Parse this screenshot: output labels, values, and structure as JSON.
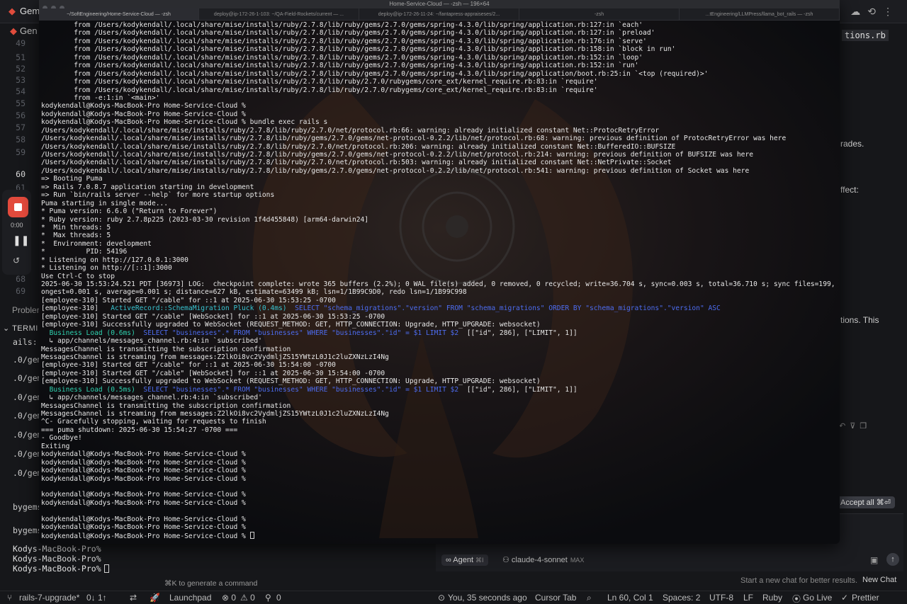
{
  "editor": {
    "tab_title": "Gem",
    "tab2_title": "Gen",
    "line_numbers": [
      "49",
      "51",
      "52",
      "53",
      "54",
      "55",
      "56",
      "57",
      "58",
      "59",
      "60",
      "61",
      "67",
      "68",
      "69"
    ],
    "active_line": "60",
    "problems_label": "Probler",
    "terminal_label": "TERMI",
    "terminal_fragments": [
      "ails::",
      ".0/gem",
      ".0/gem",
      ".0/gem",
      ".0/gem",
      ".0/gem",
      ".0/gem",
      ".0/gem",
      "bygems",
      "bygems"
    ],
    "bottom_prompts": [
      "Kodys-MacBook-Pro%",
      "Kodys-MacBook-Pro%",
      "Kodys-MacBook-Pro%"
    ],
    "generate_hint": "⌘K to generate a command"
  },
  "chat": {
    "file_chip": "tions.rb",
    "fragments": [
      "rades.",
      "ffect:",
      "tions. This"
    ],
    "accept_all": "Accept all ⌘⏎",
    "agent_label": "∞ Agent",
    "agent_kbd": "⌘I",
    "model_label": "claude-4-sonnet",
    "model_badge": "MAX",
    "hint": "Start a new chat for better results.",
    "new_chat": "New Chat"
  },
  "recording": {
    "time": "0:00"
  },
  "statusbar": {
    "branch": "rails-7-upgrade*",
    "sync": "0↓ 1↑",
    "launchpad": "Launchpad",
    "errors": "⊗ 0",
    "warnings": "⚠ 0",
    "ports": "0",
    "blame": "You, 35 seconds ago",
    "cursor_tab": "Cursor Tab",
    "position": "Ln 60, Col 1",
    "spaces": "Spaces: 2",
    "encoding": "UTF-8",
    "eol": "LF",
    "language": "Ruby",
    "go_live": "Go Live",
    "prettier": "Prettier"
  },
  "terminal": {
    "window_title": "Home-Service-Cloud — -zsh — 196×64",
    "tabs": [
      "~/SoftEngineering/Home-Service-Cloud — -zsh",
      "deploy@ip-172-26-1-103: ~/QA-Field-Rockets/current — ...",
      "deploy@ip-172-26-11-24: ~/fantapress-appraiseses/2...",
      "-zsh",
      "...tEngineering/LLMPress/llama_bot_rails — -zsh"
    ],
    "lines": [
      [
        {
          "t": "        from /Users/kodykendall/.local/share/mise/installs/ruby/2.7.8/lib/ruby/gems/2.7.0/gems/spring-4.3.0/lib/spring/application.rb:127:in `each'"
        }
      ],
      [
        {
          "t": "        from /Users/kodykendall/.local/share/mise/installs/ruby/2.7.8/lib/ruby/gems/2.7.0/gems/spring-4.3.0/lib/spring/application.rb:127:in `preload'"
        }
      ],
      [
        {
          "t": "        from /Users/kodykendall/.local/share/mise/installs/ruby/2.7.8/lib/ruby/gems/2.7.0/gems/spring-4.3.0/lib/spring/application.rb:176:in `serve'"
        }
      ],
      [
        {
          "t": "        from /Users/kodykendall/.local/share/mise/installs/ruby/2.7.8/lib/ruby/gems/2.7.0/gems/spring-4.3.0/lib/spring/application.rb:158:in `block in run'"
        }
      ],
      [
        {
          "t": "        from /Users/kodykendall/.local/share/mise/installs/ruby/2.7.8/lib/ruby/gems/2.7.0/gems/spring-4.3.0/lib/spring/application.rb:152:in `loop'"
        }
      ],
      [
        {
          "t": "        from /Users/kodykendall/.local/share/mise/installs/ruby/2.7.8/lib/ruby/gems/2.7.0/gems/spring-4.3.0/lib/spring/application.rb:152:in `run'"
        }
      ],
      [
        {
          "t": "        from /Users/kodykendall/.local/share/mise/installs/ruby/2.7.8/lib/ruby/gems/2.7.0/gems/spring-4.3.0/lib/spring/application/boot.rb:25:in `<top (required)>'"
        }
      ],
      [
        {
          "t": "        from /Users/kodykendall/.local/share/mise/installs/ruby/2.7.8/lib/ruby/2.7.0/rubygems/core_ext/kernel_require.rb:83:in `require'"
        }
      ],
      [
        {
          "t": "        from /Users/kodykendall/.local/share/mise/installs/ruby/2.7.8/lib/ruby/2.7.0/rubygems/core_ext/kernel_require.rb:83:in `require'"
        }
      ],
      [
        {
          "t": "        from -e:1:in `<main>'"
        }
      ],
      [
        {
          "t": "kodykendall@Kodys-MacBook-Pro Home-Service-Cloud %"
        }
      ],
      [
        {
          "t": "kodykendall@Kodys-MacBook-Pro Home-Service-Cloud %"
        }
      ],
      [
        {
          "t": "kodykendall@Kodys-MacBook-Pro Home-Service-Cloud % bundle exec rails s"
        }
      ],
      [
        {
          "t": "/Users/kodykendall/.local/share/mise/installs/ruby/2.7.8/lib/ruby/2.7.0/net/protocol.rb:66: warning: already initialized constant Net::ProtocRetryError"
        }
      ],
      [
        {
          "t": "/Users/kodykendall/.local/share/mise/installs/ruby/2.7.8/lib/ruby/gems/2.7.0/gems/net-protocol-0.2.2/lib/net/protocol.rb:68: warning: previous definition of ProtocRetryError was here"
        }
      ],
      [
        {
          "t": "/Users/kodykendall/.local/share/mise/installs/ruby/2.7.8/lib/ruby/2.7.0/net/protocol.rb:206: warning: already initialized constant Net::BufferedIO::BUFSIZE"
        }
      ],
      [
        {
          "t": "/Users/kodykendall/.local/share/mise/installs/ruby/2.7.8/lib/ruby/gems/2.7.0/gems/net-protocol-0.2.2/lib/net/protocol.rb:214: warning: previous definition of BUFSIZE was here"
        }
      ],
      [
        {
          "t": "/Users/kodykendall/.local/share/mise/installs/ruby/2.7.8/lib/ruby/2.7.0/net/protocol.rb:503: warning: already initialized constant Net::NetPrivate::Socket"
        }
      ],
      [
        {
          "t": "/Users/kodykendall/.local/share/mise/installs/ruby/2.7.8/lib/ruby/gems/2.7.0/gems/net-protocol-0.2.2/lib/net/protocol.rb:541: warning: previous definition of Socket was here"
        }
      ],
      [
        {
          "t": "=> Booting Puma"
        }
      ],
      [
        {
          "t": "=> Rails 7.0.8.7 application starting in development"
        }
      ],
      [
        {
          "t": "=> Run `bin/rails server --help` for more startup options"
        }
      ],
      [
        {
          "t": "Puma starting in single mode..."
        }
      ],
      [
        {
          "t": "* Puma version: 6.6.0 (\"Return to Forever\")"
        }
      ],
      [
        {
          "t": "* Ruby version: ruby 2.7.8p225 (2023-03-30 revision 1f4d455848) [arm64-darwin24]"
        }
      ],
      [
        {
          "t": "*  Min threads: 5"
        }
      ],
      [
        {
          "t": "*  Max threads: 5"
        }
      ],
      [
        {
          "t": "*  Environment: development"
        }
      ],
      [
        {
          "t": "*          PID: 54196"
        }
      ],
      [
        {
          "t": "* Listening on http://127.0.0.1:3000"
        }
      ],
      [
        {
          "t": "* Listening on http://[::1]:3000"
        }
      ],
      [
        {
          "t": "Use Ctrl-C to stop"
        }
      ],
      [
        {
          "t": "2025-06-30 15:53:24.521 PDT [36973] LOG:  checkpoint complete: wrote 365 buffers (2.2%); 0 WAL file(s) added, 0 removed, 0 recycled; write=36.704 s, sync=0.003 s, total=36.710 s; sync files=199, l"
        }
      ],
      [
        {
          "t": "ongest=0.001 s, average=0.001 s; distance=627 kB, estimate=63499 kB; lsn=1/1B99C9D0, redo lsn=1/1B99C998"
        }
      ],
      [
        {
          "t": "[employee-310] Started GET \"/cable\" for ::1 at 2025-06-30 15:53:25 -0700"
        }
      ],
      [
        {
          "t": "[employee-310]   "
        },
        {
          "t": "ActiveRecord::SchemaMigration Pluck (0.4ms)",
          "c": "cyan"
        },
        {
          "t": "  "
        },
        {
          "t": "SELECT \"schema_migrations\".\"version\" FROM \"schema_migrations\" ORDER BY \"schema_migrations\".\"version\" ASC",
          "c": "blue"
        }
      ],
      [
        {
          "t": "[employee-310] Started GET \"/cable\" [WebSocket] for ::1 at 2025-06-30 15:53:25 -0700"
        }
      ],
      [
        {
          "t": "[employee-310] Successfully upgraded to WebSocket (REQUEST_METHOD: GET, HTTP_CONNECTION: Upgrade, HTTP_UPGRADE: websocket)"
        }
      ],
      [
        {
          "t": "  "
        },
        {
          "t": "Business Load (0.6ms)",
          "c": "green"
        },
        {
          "t": "  "
        },
        {
          "t": "SELECT \"businesses\".* FROM \"businesses\" WHERE \"businesses\".\"id\" = $1 LIMIT $2",
          "c": "blue"
        },
        {
          "t": "  [[\"id\", 286], [\"LIMIT\", 1]]"
        }
      ],
      [
        {
          "t": "  ↳ app/channels/messages_channel.rb:4:in `subscribed'"
        }
      ],
      [
        {
          "t": "MessagesChannel is transmitting the subscription confirmation"
        }
      ],
      [
        {
          "t": "MessagesChannel is streaming from messages:Z2lkOi8vc2VydmljZS15YWtzL0J1c2luZXNzLzI4Ng"
        }
      ],
      [
        {
          "t": "[employee-310] Started GET \"/cable\" for ::1 at 2025-06-30 15:54:00 -0700"
        }
      ],
      [
        {
          "t": "[employee-310] Started GET \"/cable\" [WebSocket] for ::1 at 2025-06-30 15:54:00 -0700"
        }
      ],
      [
        {
          "t": "[employee-310] Successfully upgraded to WebSocket (REQUEST_METHOD: GET, HTTP_CONNECTION: Upgrade, HTTP_UPGRADE: websocket)"
        }
      ],
      [
        {
          "t": "  "
        },
        {
          "t": "Business Load (0.5ms)",
          "c": "green"
        },
        {
          "t": "  "
        },
        {
          "t": "SELECT \"businesses\".* FROM \"businesses\" WHERE \"businesses\".\"id\" = $1 LIMIT $2",
          "c": "blue"
        },
        {
          "t": "  [[\"id\", 286], [\"LIMIT\", 1]]"
        }
      ],
      [
        {
          "t": "  ↳ app/channels/messages_channel.rb:4:in `subscribed'"
        }
      ],
      [
        {
          "t": "MessagesChannel is transmitting the subscription confirmation"
        }
      ],
      [
        {
          "t": "MessagesChannel is streaming from messages:Z2lkOi8vc2VydmljZS15YWtzL0J1c2luZXNzLzI4Ng"
        }
      ],
      [
        {
          "t": "^C- Gracefully stopping, waiting for requests to finish"
        }
      ],
      [
        {
          "t": "=== puma shutdown: 2025-06-30 15:54:27 -0700 ==="
        }
      ],
      [
        {
          "t": "- Goodbye!"
        }
      ],
      [
        {
          "t": "Exiting"
        }
      ],
      [
        {
          "t": "kodykendall@Kodys-MacBook-Pro Home-Service-Cloud %"
        }
      ],
      [
        {
          "t": "kodykendall@Kodys-MacBook-Pro Home-Service-Cloud %"
        }
      ],
      [
        {
          "t": "kodykendall@Kodys-MacBook-Pro Home-Service-Cloud %"
        }
      ],
      [
        {
          "t": "kodykendall@Kodys-MacBook-Pro Home-Service-Cloud %"
        }
      ],
      [
        {
          "t": ""
        }
      ],
      [
        {
          "t": "kodykendall@Kodys-MacBook-Pro Home-Service-Cloud %"
        }
      ],
      [
        {
          "t": "kodykendall@Kodys-MacBook-Pro Home-Service-Cloud %"
        }
      ],
      [
        {
          "t": ""
        }
      ],
      [
        {
          "t": "kodykendall@Kodys-MacBook-Pro Home-Service-Cloud %"
        }
      ],
      [
        {
          "t": "kodykendall@Kodys-MacBook-Pro Home-Service-Cloud %"
        }
      ],
      [
        {
          "t": "kodykendall@Kodys-MacBook-Pro Home-Service-Cloud % "
        }
      ]
    ]
  }
}
